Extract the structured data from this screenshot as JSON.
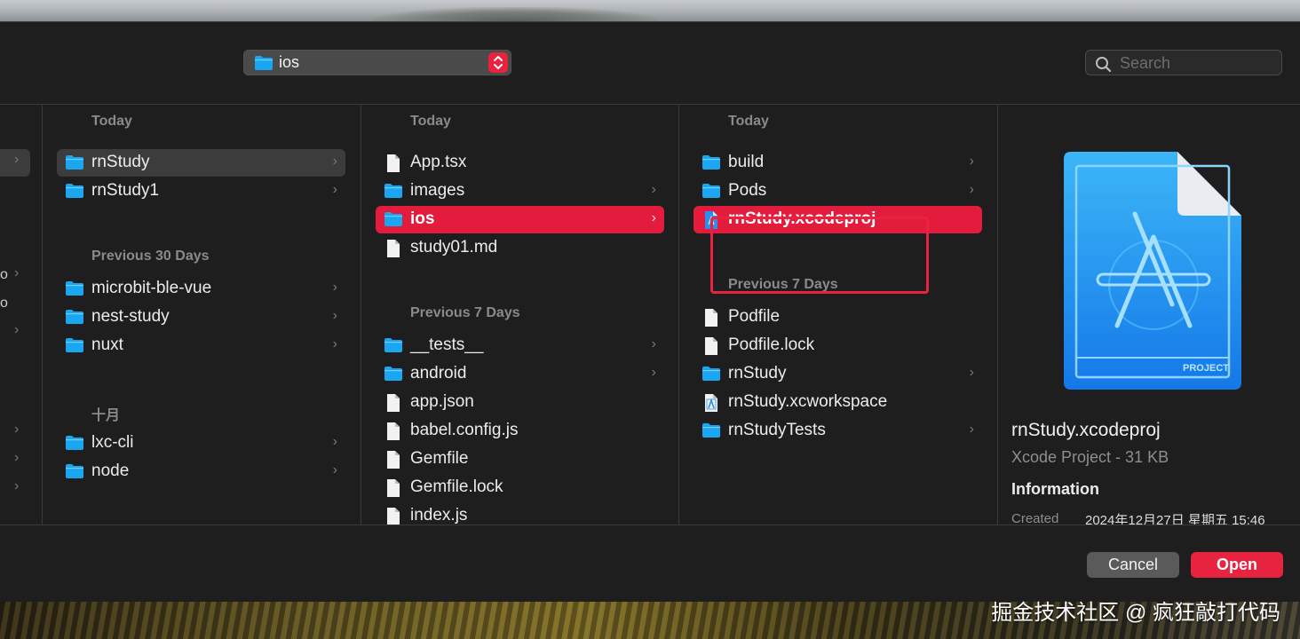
{
  "toolbar": {
    "path_label": "ios",
    "search_placeholder": "Search"
  },
  "column1": {
    "groups": [
      {
        "header": "Today",
        "items": [
          {
            "name": "rnStudy",
            "kind": "folder",
            "chevron": "›"
          },
          {
            "name": "rnStudy1",
            "kind": "folder",
            "chevron": "›"
          }
        ]
      },
      {
        "header": "Previous 30 Days",
        "items": [
          {
            "name": "microbit-ble-vue",
            "kind": "folder",
            "chevron": "›"
          },
          {
            "name": "nest-study",
            "kind": "folder",
            "chevron": "›"
          },
          {
            "name": "nuxt",
            "kind": "folder",
            "chevron": "›"
          }
        ]
      },
      {
        "header": "十月",
        "items": [
          {
            "name": "lxc-cli",
            "kind": "folder",
            "chevron": "›"
          },
          {
            "name": "node",
            "kind": "folder",
            "chevron": "›"
          }
        ]
      }
    ]
  },
  "column2": {
    "groups": [
      {
        "header": "Today",
        "items": [
          {
            "name": "App.tsx",
            "kind": "file",
            "chevron": ""
          },
          {
            "name": "images",
            "kind": "folder",
            "chevron": "›"
          },
          {
            "name": "ios",
            "kind": "folder",
            "chevron": "›"
          },
          {
            "name": "study01.md",
            "kind": "file",
            "chevron": ""
          }
        ]
      },
      {
        "header": "Previous 7 Days",
        "items": [
          {
            "name": "__tests__",
            "kind": "folder",
            "chevron": "›"
          },
          {
            "name": "android",
            "kind": "folder",
            "chevron": "›"
          },
          {
            "name": "app.json",
            "kind": "file",
            "chevron": ""
          },
          {
            "name": "babel.config.js",
            "kind": "file",
            "chevron": ""
          },
          {
            "name": "Gemfile",
            "kind": "file",
            "chevron": ""
          },
          {
            "name": "Gemfile.lock",
            "kind": "file",
            "chevron": ""
          },
          {
            "name": "index.js",
            "kind": "file",
            "chevron": ""
          }
        ]
      }
    ]
  },
  "column3": {
    "groups": [
      {
        "header": "Today",
        "items": [
          {
            "name": "build",
            "kind": "folder",
            "chevron": "›"
          },
          {
            "name": "Pods",
            "kind": "folder",
            "chevron": "›"
          },
          {
            "name": "rnStudy.xcodeproj",
            "kind": "xcodeproj",
            "chevron": ""
          }
        ]
      },
      {
        "header": "Previous 7 Days",
        "items": [
          {
            "name": "Podfile",
            "kind": "file",
            "chevron": ""
          },
          {
            "name": "Podfile.lock",
            "kind": "file",
            "chevron": ""
          },
          {
            "name": "rnStudy",
            "kind": "folder",
            "chevron": "›"
          },
          {
            "name": "rnStudy.xcworkspace",
            "kind": "xcworkspace",
            "chevron": ""
          },
          {
            "name": "rnStudyTests",
            "kind": "folder",
            "chevron": "›"
          }
        ]
      }
    ]
  },
  "column0": {
    "fragments": [
      "o",
      "o"
    ],
    "chevron": "›"
  },
  "preview": {
    "name": "rnStudy.xcodeproj",
    "kind": "Xcode Project - 31 KB",
    "info_heading": "Information",
    "created_label": "Created",
    "created_value": "2024年12月27日 星期五 15:46",
    "icon_badge": "PROJECT"
  },
  "buttons": {
    "cancel": "Cancel",
    "open": "Open"
  },
  "watermark": "掘金技术社区 @ 疯狂敲打代码",
  "colors": {
    "accent": "#e8233f",
    "folder": "#1aa6f0",
    "background": "#1e1e1e"
  }
}
